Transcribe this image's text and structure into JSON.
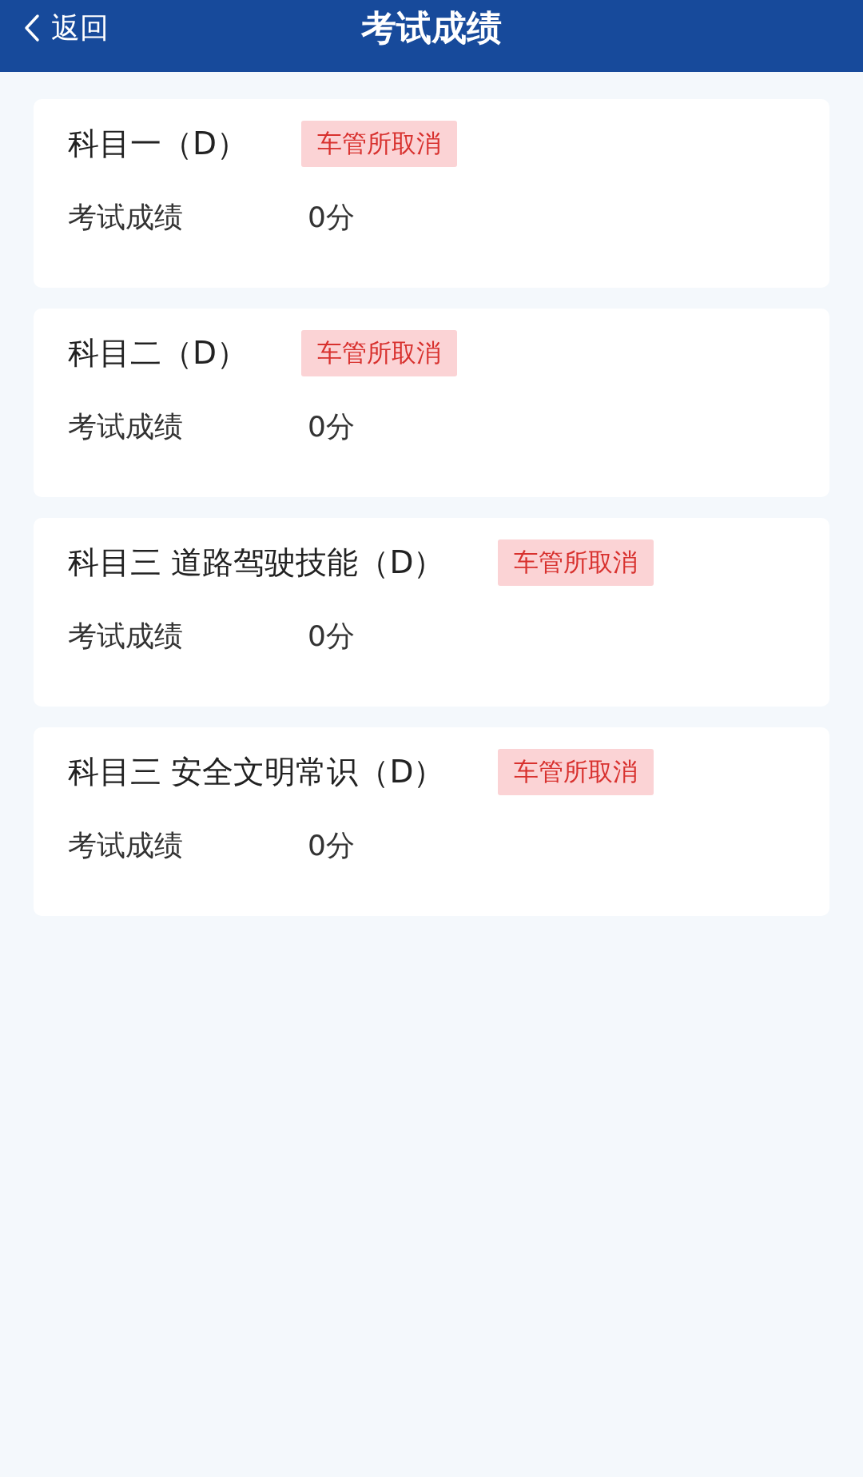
{
  "header": {
    "back_label": "返回",
    "title": "考试成绩"
  },
  "subjects": [
    {
      "name": "科目一（D）",
      "status": "车管所取消",
      "score_label": "考试成绩",
      "score": "0分"
    },
    {
      "name": "科目二（D）",
      "status": "车管所取消",
      "score_label": "考试成绩",
      "score": "0分"
    },
    {
      "name": "科目三 道路驾驶技能（D）",
      "status": "车管所取消",
      "score_label": "考试成绩",
      "score": "0分"
    },
    {
      "name": "科目三 安全文明常识（D）",
      "status": "车管所取消",
      "score_label": "考试成绩",
      "score": "0分"
    }
  ]
}
